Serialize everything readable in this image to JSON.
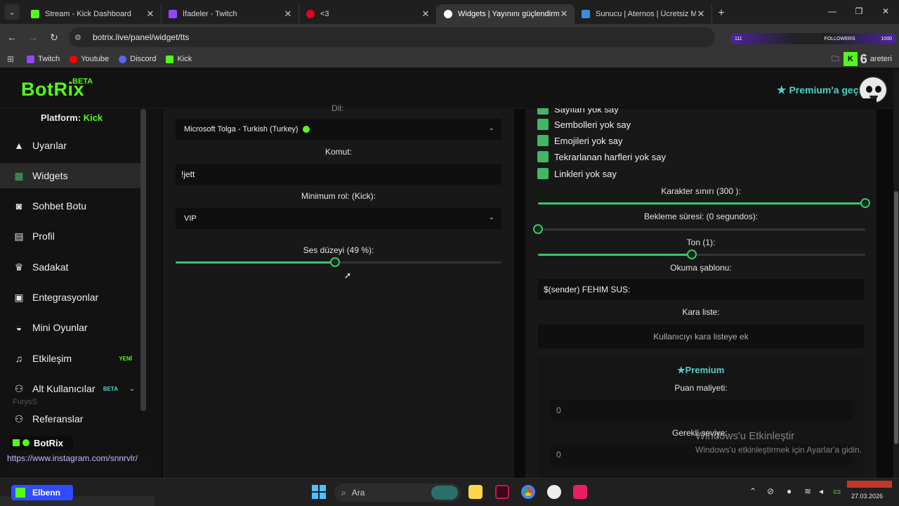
{
  "browser": {
    "tabs": [
      {
        "title": "Stream - Kick Dashboard",
        "color": "#53fc18"
      },
      {
        "title": "İfadeler - Twitch",
        "color": "#9146ff"
      },
      {
        "title": "<3",
        "color": "#e60023"
      },
      {
        "title": "Widgets | Yayınını güçlendirmek",
        "color": "#ffffff"
      },
      {
        "title": "Sunucu | Aternos | Ücretsiz Min",
        "color": "#3a8dde"
      }
    ],
    "url": "botrix.live/panel/widget/tts",
    "extension_text": "FOLLOWERS",
    "extension_left": "111",
    "extension_right": "1000",
    "bookmarks": [
      {
        "label": "Twitch",
        "color": "#9146ff"
      },
      {
        "label": "Youtube",
        "color": "#ff0000"
      },
      {
        "label": "Discord",
        "color": "#5865f2"
      },
      {
        "label": "Kick",
        "color": "#53fc18"
      }
    ],
    "bookmarks_right": "areteri",
    "kick_count": "6"
  },
  "header": {
    "logo": "BotRix",
    "beta": "BETA",
    "premium_cta": "Premium'a geç"
  },
  "sidebar": {
    "platform_label": "Platform:",
    "platform_value": "Kick",
    "items": [
      {
        "label": "Uyarılar",
        "icon": "warning-icon"
      },
      {
        "label": "Widgets",
        "icon": "grid-icon"
      },
      {
        "label": "Sohbet Botu",
        "icon": "robot-icon"
      },
      {
        "label": "Profil",
        "icon": "id-card-icon"
      },
      {
        "label": "Sadakat",
        "icon": "trophy-icon"
      },
      {
        "label": "Entegrasyonlar",
        "icon": "integration-icon"
      },
      {
        "label": "Mini Oyunlar",
        "icon": "gamepad-icon"
      },
      {
        "label": "Etkileşim",
        "icon": "music-icon",
        "badge": "YENİ"
      },
      {
        "label": "Alt Kullanıcılar",
        "icon": "users-icon",
        "badge": "BETA"
      },
      {
        "label": "Referanslar",
        "icon": "referral-icon"
      }
    ],
    "overlay_furys": "FurysS",
    "overlay_botrix": "BotRix",
    "overlay_insta": "https://www.instagram.com/snnrvlr/"
  },
  "left_panel": {
    "voice_label": "Dil:",
    "voice_value": "Microsoft Tolga - Turkish (Turkey)",
    "command_label": "Komut:",
    "command_value": "!jett",
    "min_role_label": "Minimum rol: (Kick):",
    "min_role_value": "VIP",
    "volume_label": "Ses düzeyi (49 %):",
    "volume": 0.49
  },
  "right_panel": {
    "checks": [
      "Sayıları yok say",
      "Sembolleri yok say",
      "Emojileri yok say",
      "Tekrarlanan harfleri yok say",
      "Linkleri yok say"
    ],
    "char_limit_label": "Karakter sınırı (300 ):",
    "char_limit": 1.0,
    "cooldown_label": "Bekleme süresi: (0 segundos):",
    "cooldown": 0.0,
    "tone_label": "Ton (1):",
    "tone": 0.47,
    "template_label": "Okuma şablonu:",
    "template_value": "$(sender) FEHIM SUS:",
    "blacklist_label": "Kara liste:",
    "blacklist_placeholder": "Kullanıcıyı kara listeye ek",
    "premium_title": "Premium",
    "cost_label": "Puan maliyeti:",
    "cost_value": "0",
    "level_label": "Gerekli seviye:",
    "level_value": "0"
  },
  "windows": {
    "activate_title": "Windows'u Etkinleştir",
    "activate_sub": "Windows'u etkinleştirmek için Ayarlar'a gidin.",
    "search": "Ara",
    "taskbar_app": "Elbenn",
    "date": "27.03.2026"
  },
  "colors": {
    "accent": "#53fc18",
    "premium": "#4fd1c5",
    "slider": "#3cc46c"
  }
}
